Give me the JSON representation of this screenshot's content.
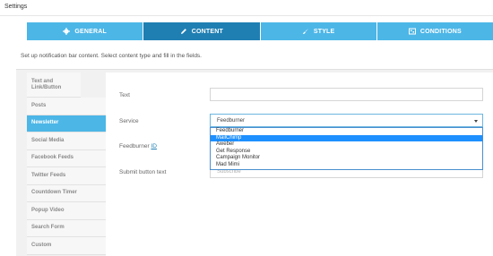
{
  "window": {
    "title": "Settings"
  },
  "tabs": [
    {
      "label": "GENERAL",
      "icon": "gear-icon",
      "active": false
    },
    {
      "label": "CONTENT",
      "icon": "pencil-icon",
      "active": true
    },
    {
      "label": "STYLE",
      "icon": "brush-icon",
      "active": false
    },
    {
      "label": "CONDITIONS",
      "icon": "conditions-icon",
      "active": false
    }
  ],
  "intro": "Set up notification bar content. Select content type and fill in the fields.",
  "sidebar": {
    "items": [
      {
        "label": "Text and Link/Button",
        "active": false
      },
      {
        "label": "Posts",
        "active": false
      },
      {
        "label": "Newsletter",
        "active": true
      },
      {
        "label": "Social Media",
        "active": false
      },
      {
        "label": "Facebook Feeds",
        "active": false
      },
      {
        "label": "Twitter Feeds",
        "active": false
      },
      {
        "label": "Countdown Timer",
        "active": false
      },
      {
        "label": "Popup Video",
        "active": false
      },
      {
        "label": "Search Form",
        "active": false
      },
      {
        "label": "Custom",
        "active": false
      }
    ]
  },
  "form": {
    "text_label": "Text",
    "text_value": "",
    "service_label": "Service",
    "service_value": "Feedburner",
    "feedburner_label": "Feedburner",
    "feedburner_link": "ID",
    "submit_label": "Submit button text",
    "submit_placeholder": "Subscribe"
  },
  "dropdown": {
    "options": [
      "Feedburner",
      "MailChimp",
      "Aweber",
      "Get Response",
      "Campaign Monitor",
      "Mad Mimi"
    ],
    "highlighted": "MailChimp"
  },
  "colors": {
    "tab": "#4cb6e7",
    "tab_active": "#1f7fb3",
    "highlight": "#1e90ff"
  }
}
